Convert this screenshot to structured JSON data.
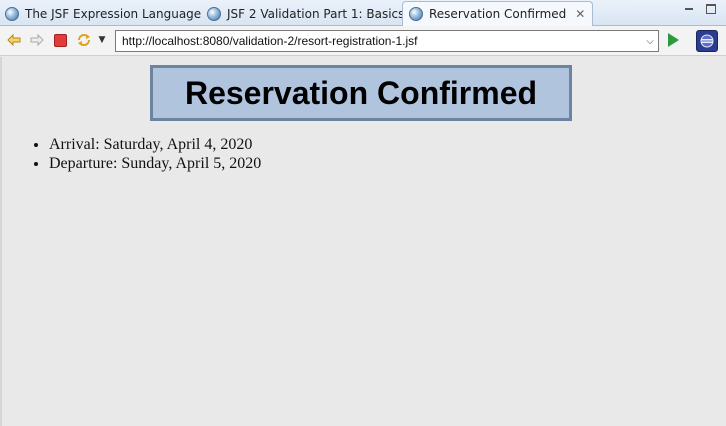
{
  "tabs": [
    {
      "label": "The JSF Expression Language",
      "active": false
    },
    {
      "label": "JSF 2 Validation Part 1: Basics",
      "active": false
    },
    {
      "label": "Reservation Confirmed",
      "active": true
    }
  ],
  "toolbar": {
    "url": "http://localhost:8080/validation-2/resort-registration-1.jsf",
    "icons": [
      "back-arrow-icon",
      "forward-arrow-icon",
      "stop-icon",
      "refresh-icon",
      "dropdown-icon",
      "go-icon",
      "eclipse-icon"
    ]
  },
  "page": {
    "heading": "Reservation Confirmed",
    "items": [
      "Arrival: Saturday, April 4, 2020",
      "Departure: Sunday, April 5, 2020"
    ]
  },
  "colors": {
    "heading_bg": "#b0c4de",
    "heading_border": "#6d84a1",
    "page_bg": "#e9e9e9"
  }
}
